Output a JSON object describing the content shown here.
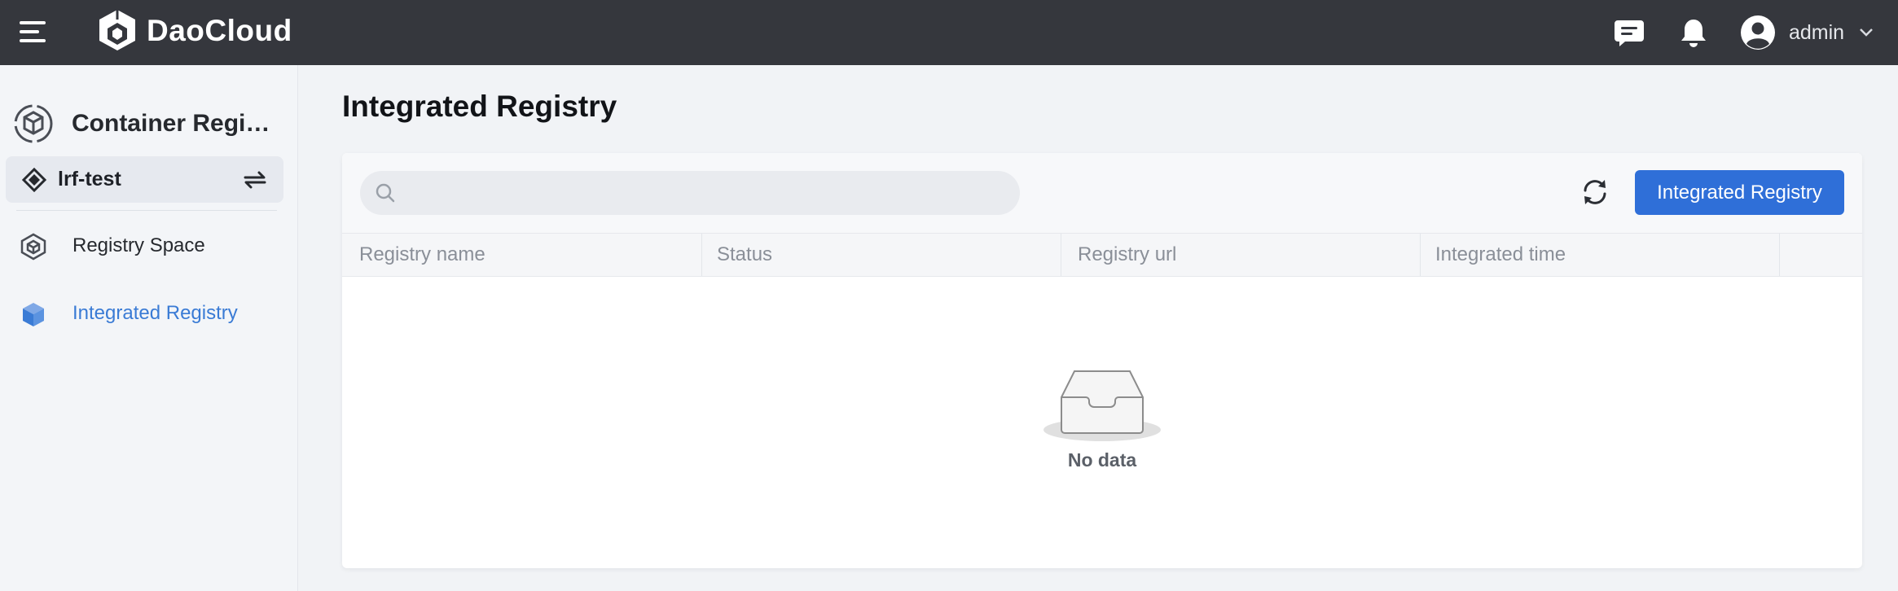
{
  "app": {
    "brand": "DaoCloud",
    "user": "admin"
  },
  "sidebar": {
    "product_title": "Container Regis...",
    "workspace": "lrf-test",
    "items": [
      {
        "label": "Registry Space",
        "icon": "registry-space-icon",
        "active": false
      },
      {
        "label": "Integrated Registry",
        "icon": "integrated-registry-icon",
        "active": true
      }
    ]
  },
  "main": {
    "title": "Integrated Registry",
    "search": {
      "placeholder": "",
      "value": ""
    },
    "create_button": "Integrated Registry",
    "columns": [
      "Registry name",
      "Status",
      "Registry url",
      "Integrated time",
      ""
    ],
    "rows": [],
    "empty_text": "No data"
  },
  "colors": {
    "topbar": "#35373d",
    "accent": "#2f6fd8",
    "active_nav": "#3a7bd5"
  }
}
